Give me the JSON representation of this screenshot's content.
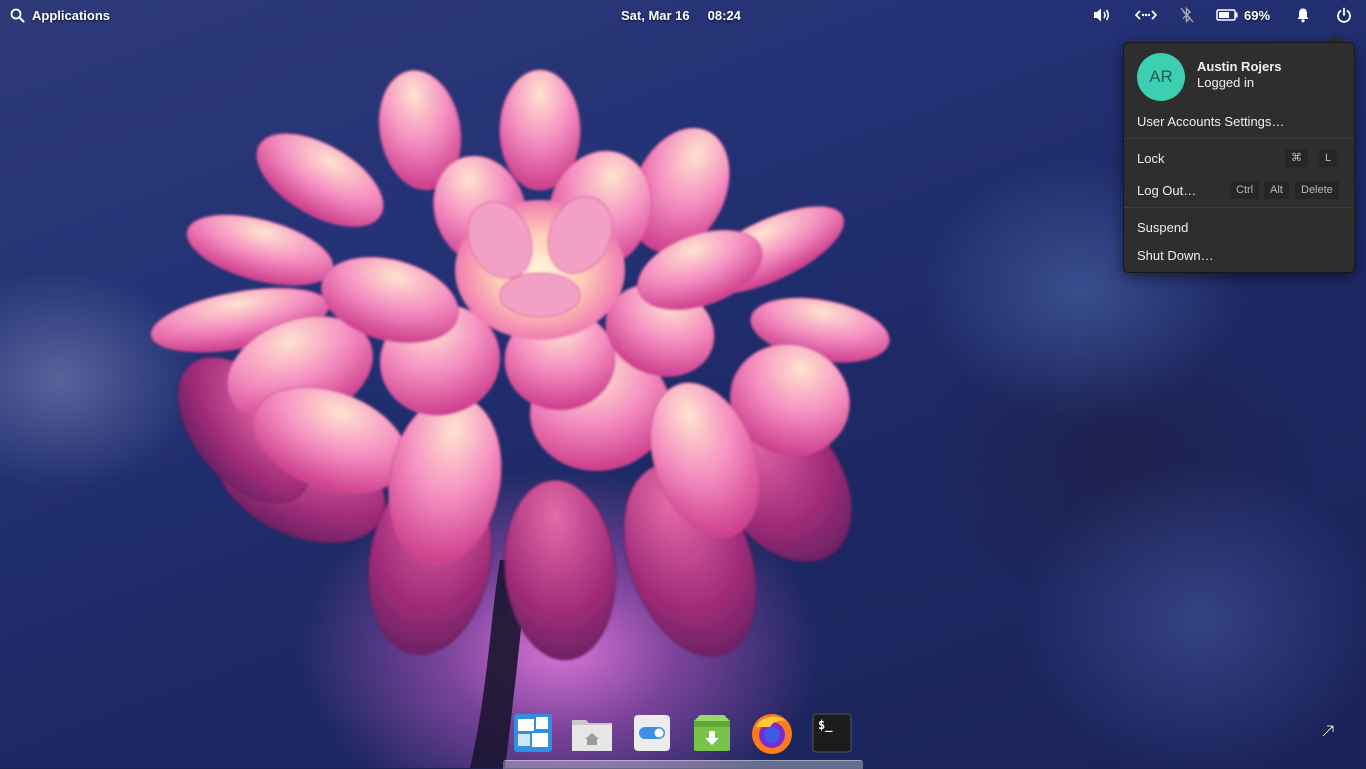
{
  "top_panel": {
    "applications_label": "Applications",
    "date": "Sat, Mar 16",
    "time": "08:24",
    "battery_percent": "69%"
  },
  "user_menu": {
    "avatar_initials": "AR",
    "user_name": "Austin Rojers",
    "user_status": "Logged in",
    "accounts_settings": "User Accounts Settings…",
    "lock": {
      "label": "Lock",
      "shortcut": [
        "⌘",
        "L"
      ]
    },
    "log_out": {
      "label": "Log Out…",
      "shortcut": [
        "Ctrl",
        "Alt",
        "Delete"
      ]
    },
    "suspend": "Suspend",
    "shut_down": "Shut Down…"
  },
  "dock": {
    "apps": [
      "multitasking-view-icon",
      "files-icon",
      "system-settings-icon",
      "appcenter-icon",
      "firefox-icon",
      "terminal-icon"
    ]
  },
  "colors": {
    "accent_avatar": "#3dcfb2",
    "popover_bg": "#2e2e2e"
  }
}
